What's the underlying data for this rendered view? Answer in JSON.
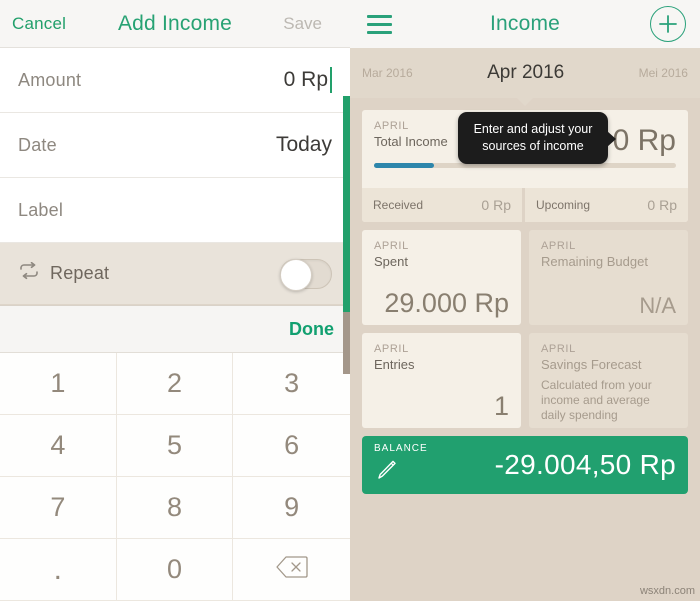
{
  "left": {
    "header": {
      "cancel_label": "Cancel",
      "title": "Add Income",
      "save_label": "Save"
    },
    "rows": [
      {
        "label": "Amount",
        "value": "0 Rp"
      },
      {
        "label": "Date",
        "value": "Today"
      },
      {
        "label": "Label",
        "value": ""
      },
      {
        "label": "Repeat",
        "value": ""
      }
    ],
    "repeat_toggle_state": "off",
    "keyboard": {
      "done_label": "Done",
      "keys": [
        "1",
        "2",
        "3",
        "4",
        "5",
        "6",
        "7",
        "8",
        "9",
        ".",
        "0",
        "delete-icon"
      ]
    }
  },
  "right": {
    "header": {
      "title": "Income"
    },
    "months": {
      "previous": "Mar 2016",
      "current": "Apr 2016",
      "next": "Mei 2016"
    },
    "total_income_card": {
      "month": "APRIL",
      "name": "Total Income",
      "value": "0 Rp",
      "progress_percent": 20,
      "received_label": "Received",
      "received_value": "0 Rp",
      "upcoming_label": "Upcoming",
      "upcoming_value": "0 Rp"
    },
    "stats": [
      {
        "month": "APRIL",
        "name": "Spent",
        "value": "29.000 Rp",
        "note": "",
        "muted": false
      },
      {
        "month": "APRIL",
        "name": "Remaining Budget",
        "value": "N/A",
        "note": "",
        "muted": true
      },
      {
        "month": "APRIL",
        "name": "Entries",
        "value": "1",
        "note": "",
        "muted": false
      },
      {
        "month": "APRIL",
        "name": "Savings Forecast",
        "value": "",
        "note": "Calculated from your income and average daily spending",
        "muted": true
      }
    ],
    "balance": {
      "label": "BALANCE",
      "value": "-29.004,50 Rp"
    }
  },
  "tooltip": {
    "text": "Enter and adjust your sources of income"
  },
  "watermark": {
    "text": "wsxdn.com"
  },
  "colors": {
    "accent_green": "#21a06f",
    "progress_blue": "#2d86ab",
    "panel_beige": "#ded3c6",
    "card_cream": "#f5f0e7",
    "tooltip_dark": "#1c1c1c"
  }
}
